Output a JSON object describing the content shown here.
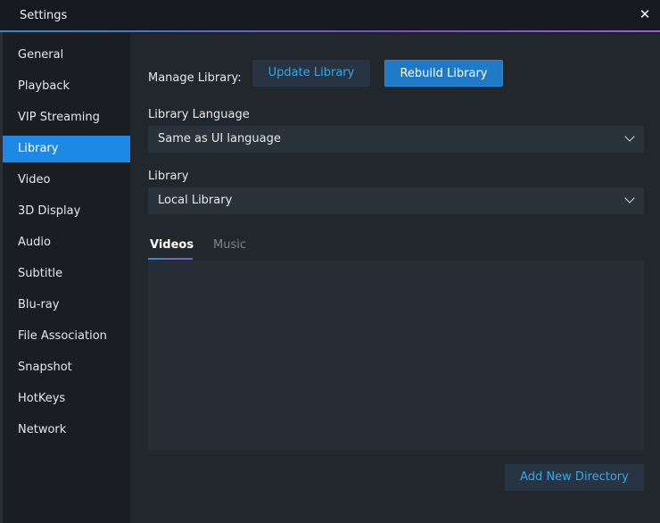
{
  "window": {
    "title": "Settings",
    "close_glyph": "✕"
  },
  "sidebar": {
    "items": [
      {
        "label": "General",
        "active": false
      },
      {
        "label": "Playback",
        "active": false
      },
      {
        "label": "VIP Streaming",
        "active": false
      },
      {
        "label": "Library",
        "active": true
      },
      {
        "label": "Video",
        "active": false
      },
      {
        "label": "3D Display",
        "active": false
      },
      {
        "label": "Audio",
        "active": false
      },
      {
        "label": "Subtitle",
        "active": false
      },
      {
        "label": "Blu-ray",
        "active": false
      },
      {
        "label": "File Association",
        "active": false
      },
      {
        "label": "Snapshot",
        "active": false
      },
      {
        "label": "HotKeys",
        "active": false
      },
      {
        "label": "Network",
        "active": false
      }
    ]
  },
  "main": {
    "manage_label": "Manage Library:",
    "update_button": "Update Library",
    "rebuild_button": "Rebuild Library",
    "language_label": "Library Language",
    "language_value": "Same as UI language",
    "library_label": "Library",
    "library_value": "Local Library",
    "tabs": [
      {
        "label": "Videos",
        "active": true
      },
      {
        "label": "Music",
        "active": false
      }
    ],
    "add_directory_button": "Add New Directory"
  },
  "colors": {
    "accent": "#1e88e5",
    "link": "#39a7e6",
    "background": "#21272d",
    "sidebar": "#1a1e23"
  }
}
